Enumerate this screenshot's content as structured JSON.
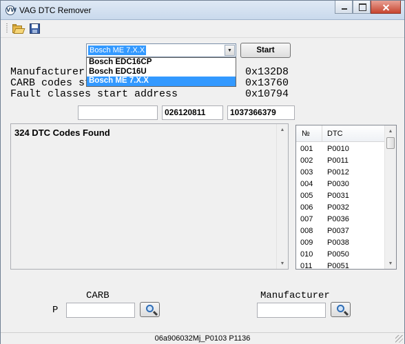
{
  "window": {
    "title": "VAG DTC Remover",
    "app_icon": "VW",
    "controls": [
      "minimize-icon",
      "maximize-icon",
      "close-icon"
    ]
  },
  "toolbar": {
    "buttons": [
      {
        "name": "open",
        "icon": "folder-open-icon"
      },
      {
        "name": "save",
        "icon": "floppy-disk-icon"
      }
    ]
  },
  "ecu_select": {
    "selected": "Bosch ME 7.X.X",
    "options": [
      "Bosch EDC16CP",
      "Bosch EDC16U",
      "Bosch ME 7.X.X"
    ],
    "highlighted_option": "Bosch ME 7.X.X"
  },
  "start_button": {
    "label": "Start"
  },
  "info": [
    {
      "label": "Manufacturer start address",
      "value": "0x132D8"
    },
    {
      "label": "CARB codes start address",
      "value": "0x13760"
    },
    {
      "label": "Fault classes start address",
      "value": "0x10794"
    }
  ],
  "fields": {
    "field1": "",
    "field2": "026120811",
    "field3": "1037366379"
  },
  "main_text": "324  DTC Codes Found",
  "dtc_table": {
    "headers": {
      "number": "№",
      "code": "DTC"
    },
    "rows": [
      {
        "no": "001",
        "dtc": "P0010"
      },
      {
        "no": "002",
        "dtc": "P0011"
      },
      {
        "no": "003",
        "dtc": "P0012"
      },
      {
        "no": "004",
        "dtc": "P0030"
      },
      {
        "no": "005",
        "dtc": "P0031"
      },
      {
        "no": "006",
        "dtc": "P0032"
      },
      {
        "no": "007",
        "dtc": "P0036"
      },
      {
        "no": "008",
        "dtc": "P0037"
      },
      {
        "no": "009",
        "dtc": "P0038"
      },
      {
        "no": "010",
        "dtc": "P0050"
      },
      {
        "no": "011",
        "dtc": "P0051"
      }
    ]
  },
  "search": {
    "carb_label": "CARB",
    "p_prefix": "P",
    "carb_value": "",
    "manufacturer_label": "Manufacturer",
    "manufacturer_value": "",
    "button_icon": "magnifier-icon"
  },
  "status": {
    "text": "06a906032Mj_P0103 P1136"
  },
  "colors": {
    "selection": "#3399ff",
    "window_bg": "#f0f0f0"
  }
}
